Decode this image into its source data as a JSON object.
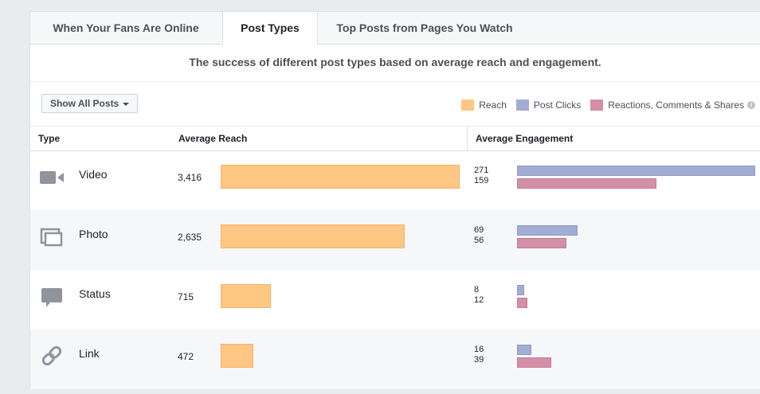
{
  "tabs": [
    {
      "label": "When Your Fans Are Online",
      "active": false
    },
    {
      "label": "Post Types",
      "active": true
    },
    {
      "label": "Top Posts from Pages You Watch",
      "active": false
    }
  ],
  "subtitle": "The success of different post types based on average reach and engagement.",
  "filter": {
    "label": "Show All Posts"
  },
  "legend": [
    {
      "label": "Reach",
      "color": "#ffc684"
    },
    {
      "label": "Post Clicks",
      "color": "#a1add2"
    },
    {
      "label": "Reactions, Comments & Shares",
      "color": "#d38fa6"
    }
  ],
  "legend_info_glyph": "i",
  "columns": {
    "type": "Type",
    "reach": "Average Reach",
    "engagement": "Average Engagement"
  },
  "rows": [
    {
      "type": "Video",
      "icon": "video-camera-icon",
      "reach": "3,416",
      "reach_value": 3416,
      "clicks": "271",
      "clicks_value": 271,
      "reactions": "159",
      "reactions_value": 159
    },
    {
      "type": "Photo",
      "icon": "photo-icon",
      "reach": "2,635",
      "reach_value": 2635,
      "clicks": "69",
      "clicks_value": 69,
      "reactions": "56",
      "reactions_value": 56
    },
    {
      "type": "Status",
      "icon": "speech-bubble-icon",
      "reach": "715",
      "reach_value": 715,
      "clicks": "8",
      "clicks_value": 8,
      "reactions": "12",
      "reactions_value": 12
    },
    {
      "type": "Link",
      "icon": "link-icon",
      "reach": "472",
      "reach_value": 472,
      "clicks": "16",
      "clicks_value": 16,
      "reactions": "39",
      "reactions_value": 39
    }
  ]
}
